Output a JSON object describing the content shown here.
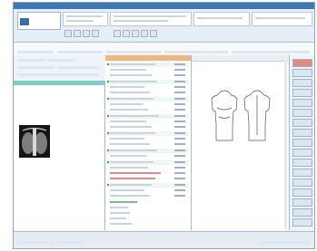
{
  "window": {
    "title": ""
  },
  "header": {
    "logo_text": ""
  },
  "toolbar": {
    "labels": [
      "",
      "",
      "",
      "",
      "",
      "",
      ""
    ]
  },
  "patient": {
    "name": "",
    "id": ""
  },
  "left_pane": {
    "header": "",
    "notes": [
      "",
      "",
      "",
      ""
    ],
    "image_label": ""
  },
  "middle_pane": {
    "header": ""
  },
  "draw_pane": {
    "header": ""
  },
  "status": {
    "text": ""
  },
  "colors": {
    "title_bar": "#3f76b8",
    "left_header": "#7fd1c8",
    "middle_header": "#f3b57c",
    "accent_red": "#e98686",
    "accent_green": "#5c9e4c"
  },
  "icons": [
    "logo-icon",
    "toolbar-button-icon",
    "checkbox-icon",
    "body-front-icon",
    "body-back-icon"
  ]
}
